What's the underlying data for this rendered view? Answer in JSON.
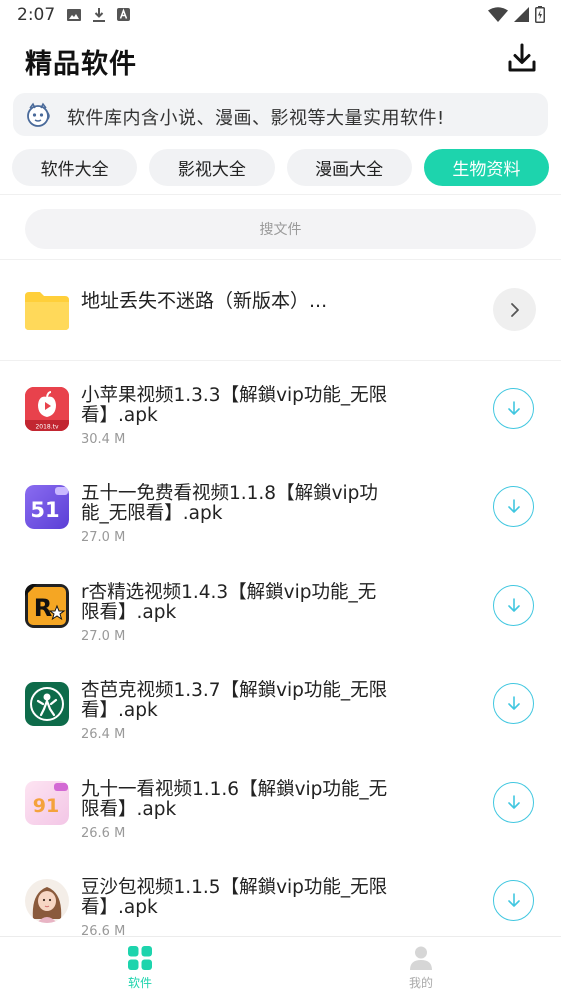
{
  "status_bar": {
    "time": "2:07"
  },
  "header": {
    "title": "精品软件"
  },
  "notice": {
    "text": "软件库内含小说、漫画、影视等大量实用软件!"
  },
  "tabs": [
    {
      "label": "软件大全"
    },
    {
      "label": "影视大全"
    },
    {
      "label": "漫画大全"
    },
    {
      "label": "生物资料",
      "active": true
    }
  ],
  "search": {
    "placeholder": "搜文件"
  },
  "folder": {
    "title": "地址丢失不迷路（新版本）..."
  },
  "files": [
    {
      "name": "小苹果视频1.3.3【解鎖vip功能_无限看】.apk",
      "size": "30.4 M",
      "icon": "apple-video-icon"
    },
    {
      "name": "五十一免费看视频1.1.8【解鎖vip功能_无限看】.apk",
      "size": "27.0 M",
      "icon": "fiftyone-icon"
    },
    {
      "name": "r杏精选视频1.4.3【解鎖vip功能_无限看】.apk",
      "size": "27.0 M",
      "icon": "r-star-icon"
    },
    {
      "name": "杏芭克视频1.3.7【解鎖vip功能_无限看】.apk",
      "size": "26.4 M",
      "icon": "green-logo-icon"
    },
    {
      "name": "九十一看视频1.1.6【解鎖vip功能_无限看】.apk",
      "size": "26.6 M",
      "icon": "ninetyone-icon"
    },
    {
      "name": "豆沙包视频1.1.5【解鎖vip功能_无限看】.apk",
      "size": "26.6 M",
      "icon": "avatar-girl-icon"
    }
  ],
  "bottom_nav": [
    {
      "label": "软件",
      "active": true
    },
    {
      "label": "我的"
    }
  ],
  "colors": {
    "accent": "#1dd4ad",
    "download": "#41c7e0",
    "folder": "#ffd54a"
  }
}
